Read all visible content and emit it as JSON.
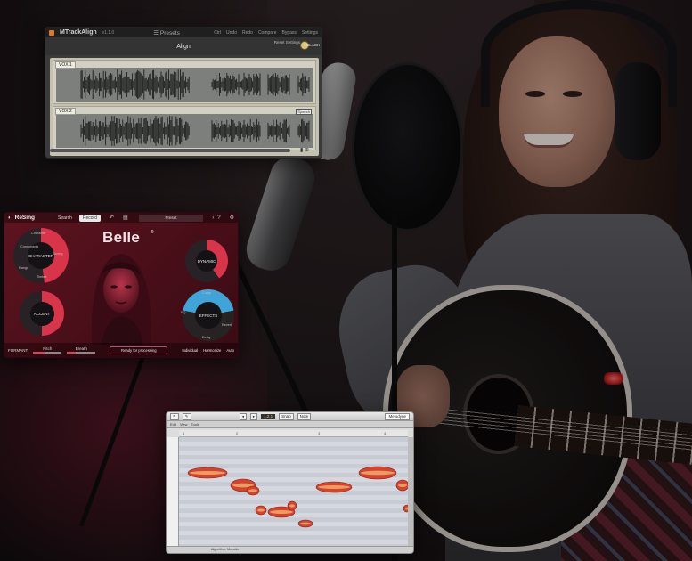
{
  "colors": {
    "resing_accent": "#d8354b",
    "resing_effects_accent": "#3fa5d8",
    "mtrack_accent": "#e0782a",
    "blob_fill": "#d9402e",
    "blob_highlight": "#e8c87a"
  },
  "mtrack": {
    "app_name": "MTrackAlign",
    "version": "v1.1.0",
    "presets_label": "☰ Presets",
    "toolbar": [
      "Ctrl",
      "Undo",
      "Redo",
      "Compare",
      "Bypass",
      "Settings"
    ],
    "section_title": "Align",
    "reset_settings": "Reset Settings",
    "theme_label": "BLACK",
    "tracks": [
      {
        "label": "VOX 1"
      },
      {
        "label": "VOX 2",
        "badge": "Speech"
      }
    ]
  },
  "resing": {
    "brand": "ReSing",
    "tabs": [
      {
        "label": "Search",
        "active": false
      },
      {
        "label": "Record",
        "active": true
      }
    ],
    "preset_field": "Preset",
    "voice_name": "Belle",
    "voice_tag": "®",
    "dials": {
      "character": "CHARACTER",
      "accent": "ACCENT",
      "dynamic": "DYNAMIC",
      "effects": "EFFECTS"
    },
    "character_labels": [
      "Character",
      "Consonants",
      "Tuning",
      "Range",
      "Timbre"
    ],
    "effects_labels": [
      "Comp",
      "EQ",
      "Reverb",
      "Delay"
    ],
    "bottom": {
      "formant_label": "FORMANT",
      "pitch_label": "Pitch",
      "breath_label": "Breath",
      "status": "Ready for processing",
      "opt_1": "Individual",
      "opt_2": "Harmonize",
      "opt_3": "Auto"
    }
  },
  "pitch_editor": {
    "lcd": "1.2.1",
    "mode": "Melodyne",
    "toolbar_boxes": [
      "◂",
      "▸",
      "Snap",
      "Note"
    ],
    "subbar": [
      "Edit",
      "View",
      "Tools"
    ],
    "ruler_marks": [
      "1",
      "2",
      "3",
      "4"
    ],
    "footer": "Algorithm: Melodic"
  }
}
